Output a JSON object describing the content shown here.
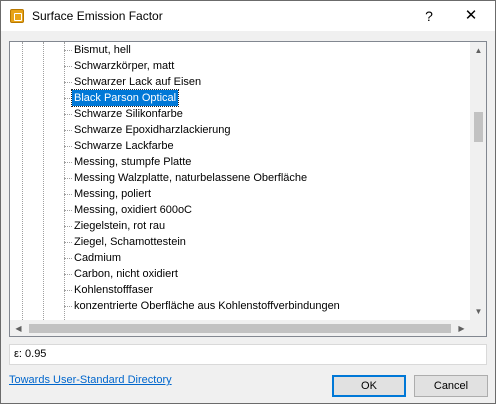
{
  "window": {
    "title": "Surface Emission Factor",
    "help_label": "?",
    "close_label": "✕"
  },
  "tree": {
    "items": [
      {
        "label": "Bismut, hell",
        "selected": false
      },
      {
        "label": "Schwarzkörper, matt",
        "selected": false
      },
      {
        "label": "Schwarzer Lack auf Eisen",
        "selected": false
      },
      {
        "label": "Black Parson Optical",
        "selected": true
      },
      {
        "label": "Schwarze Silikonfarbe",
        "selected": false
      },
      {
        "label": "Schwarze Epoxidharzlackierung",
        "selected": false
      },
      {
        "label": "Schwarze Lackfarbe",
        "selected": false
      },
      {
        "label": "Messing, stumpfe Platte",
        "selected": false
      },
      {
        "label": "Messing Walzplatte, naturbelassene Oberfläche",
        "selected": false
      },
      {
        "label": "Messing, poliert",
        "selected": false
      },
      {
        "label": "Messing, oxidiert 600oC",
        "selected": false
      },
      {
        "label": "Ziegelstein, rot rau",
        "selected": false
      },
      {
        "label": "Ziegel, Schamottestein",
        "selected": false
      },
      {
        "label": "Cadmium",
        "selected": false
      },
      {
        "label": "Carbon, nicht oxidiert",
        "selected": false
      },
      {
        "label": "Kohlenstofffaser",
        "selected": false
      },
      {
        "label": "konzentrierte Oberfläche aus Kohlenstoffverbindungen",
        "selected": false
      }
    ],
    "selection_color": "#0078d7",
    "scroll_up_icon": "▲",
    "scroll_down_icon": "▼",
    "scroll_left_icon": "◀",
    "scroll_right_icon": "▶"
  },
  "value_field": {
    "text": "ε: 0.95"
  },
  "footer": {
    "link_label": "Towards User-Standard Directory",
    "ok_label": "OK",
    "cancel_label": "Cancel"
  },
  "colors": {
    "link": "#0066cc",
    "ok_border": "#0078d7"
  }
}
